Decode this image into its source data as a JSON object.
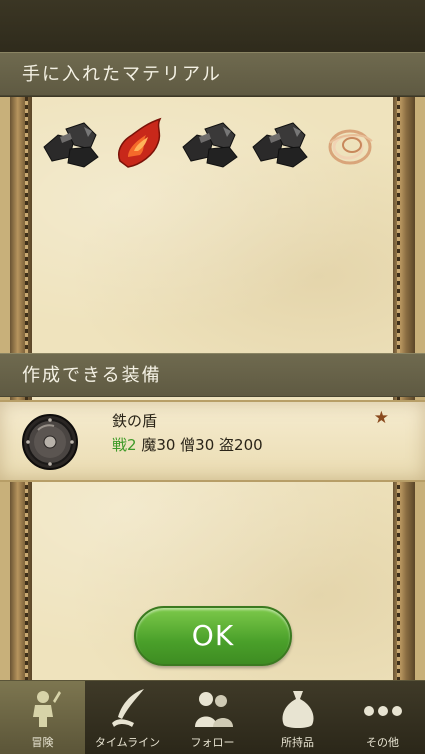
{
  "sections": {
    "materials_title": "手に入れたマテリアル",
    "craftable_title": "作成できる装備"
  },
  "materials": [
    {
      "icon": "iron-ore-icon"
    },
    {
      "icon": "fire-crystal-icon"
    },
    {
      "icon": "iron-ore-icon"
    },
    {
      "icon": "iron-ore-icon"
    },
    {
      "icon": "wool-fiber-icon"
    }
  ],
  "equipment": {
    "name": "鉄の盾",
    "stat_green": "戦2",
    "stats": "魔30 僧30 盗200",
    "star": "★",
    "icon": "round-shield-icon"
  },
  "ok_button": {
    "label": "OK"
  },
  "tabs": [
    {
      "label": "冒険",
      "icon": "adventurer-icon",
      "active": true
    },
    {
      "label": "タイムライン",
      "icon": "quill-icon",
      "active": false
    },
    {
      "label": "フォロー",
      "icon": "people-icon",
      "active": false
    },
    {
      "label": "所持品",
      "icon": "bag-icon",
      "active": false
    },
    {
      "label": "その他",
      "icon": "more-icon",
      "active": false
    }
  ],
  "colors": {
    "header_bg": "#6f6a4f",
    "parchment": "#efe3bd",
    "ok_green": "#4aa02a",
    "stat_green": "#3f9a28"
  }
}
